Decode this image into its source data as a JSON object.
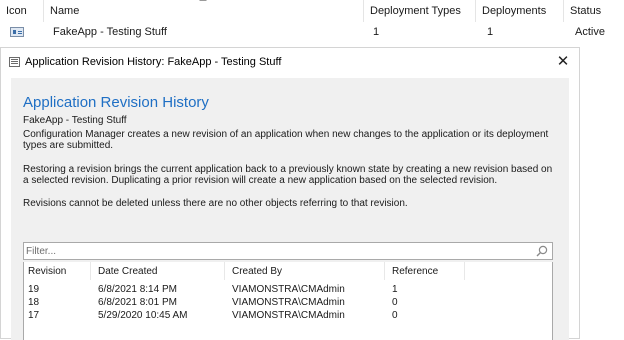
{
  "background_list": {
    "columns": [
      "Icon",
      "Name",
      "Deployment Types",
      "Deployments",
      "Status"
    ],
    "row": {
      "name": "FakeApp - Testing Stuff",
      "deployment_types": "1",
      "deployments": "1",
      "status": "Active"
    }
  },
  "dialog": {
    "title": "Application Revision History: FakeApp - Testing Stuff",
    "heading": "Application Revision History",
    "app_name": "FakeApp - Testing Stuff",
    "paragraphs": [
      "Configuration Manager creates a new revision of an application when new changes to the application or its deployment types are submitted.",
      "Restoring a revision brings the current application back to a previously known state by creating a new revision based on a selected revision. Duplicating a prior revision will create a new application based on the selected revision.",
      "Revisions cannot be deleted unless there are no other objects referring to that revision."
    ],
    "filter_placeholder": "Filter...",
    "table": {
      "headers": [
        "Revision",
        "Date Created",
        "Created By",
        "Reference"
      ],
      "rows": [
        [
          "19",
          "6/8/2021 8:14 PM",
          "VIAMONSTRA\\CMAdmin",
          "1"
        ],
        [
          "18",
          "6/8/2021 8:01 PM",
          "VIAMONSTRA\\CMAdmin",
          "0"
        ],
        [
          "17",
          "5/29/2020 10:45 AM",
          "VIAMONSTRA\\CMAdmin",
          "0"
        ]
      ]
    }
  },
  "colors": {
    "heading": "#1f6fc4",
    "panel_background": "#f0f0f0"
  },
  "icons": [
    "application-icon",
    "dialog-icon",
    "close-icon",
    "search-icon"
  ]
}
